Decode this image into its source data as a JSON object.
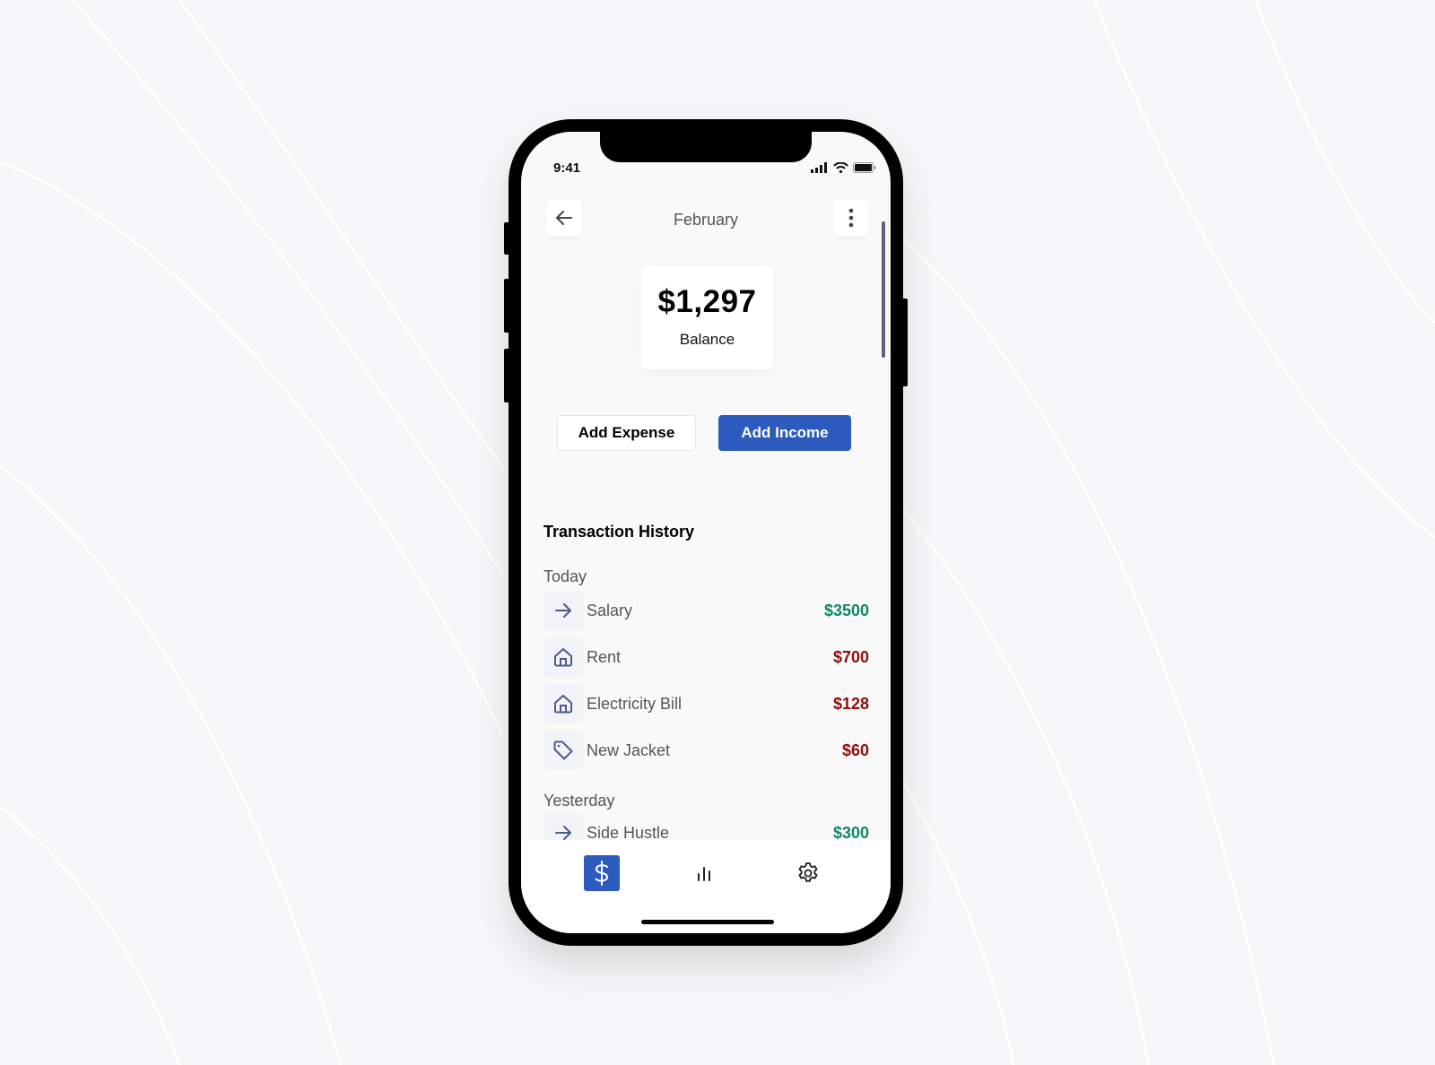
{
  "status_bar": {
    "time": "9:41"
  },
  "header": {
    "title": "February",
    "back_icon": "arrow-left-icon",
    "menu_icon": "more-vertical-icon"
  },
  "balance": {
    "amount": "$1,297",
    "label": "Balance"
  },
  "actions": {
    "add_expense": "Add Expense",
    "add_income": "Add Income"
  },
  "transactions": {
    "title": "Transaction History",
    "groups": [
      {
        "label": "Today",
        "items": [
          {
            "name": "Salary",
            "amount": "$3500",
            "type": "income",
            "icon": "arrow-right-icon"
          },
          {
            "name": "Rent",
            "amount": "$700",
            "type": "expense",
            "icon": "home-icon"
          },
          {
            "name": "Electricity Bill",
            "amount": "$128",
            "type": "expense",
            "icon": "home-icon"
          },
          {
            "name": "New Jacket",
            "amount": "$60",
            "type": "expense",
            "icon": "tag-icon"
          }
        ]
      },
      {
        "label": "Yesterday",
        "items": [
          {
            "name": "Side Hustle",
            "amount": "$300",
            "type": "income",
            "icon": "arrow-right-icon"
          }
        ]
      }
    ]
  },
  "bottom_nav": {
    "tabs": [
      {
        "name": "wallet",
        "icon": "dollar-icon",
        "active": true
      },
      {
        "name": "stats",
        "icon": "bar-chart-icon",
        "active": false
      },
      {
        "name": "settings",
        "icon": "gear-icon",
        "active": false
      }
    ]
  },
  "colors": {
    "accent": "#2d5bbd",
    "income": "#11876a",
    "expense": "#8f0d0d"
  }
}
